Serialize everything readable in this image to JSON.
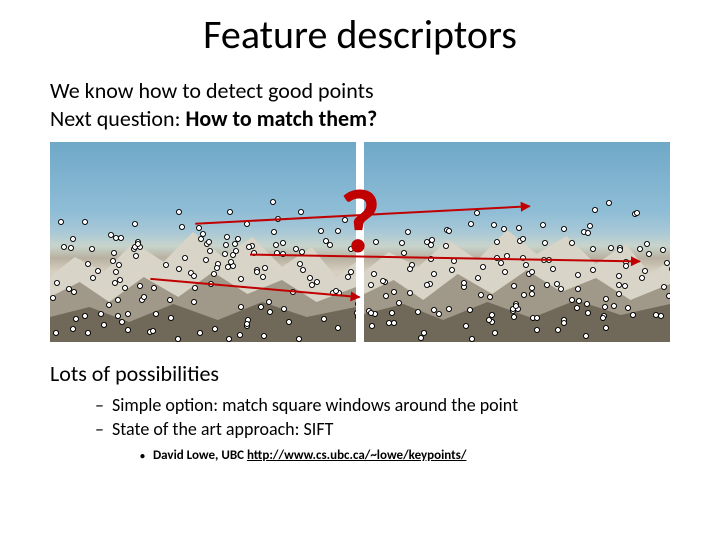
{
  "title": "Feature descriptors",
  "intro_line1": "We know how to detect good points",
  "intro_line2_a": "Next question: ",
  "intro_line2_b": "How to match them?",
  "qmark": "?",
  "poss_title": "Lots of possibilities",
  "bullet1": "Simple option:  match square windows around the point",
  "bullet2": "State of the art approach:  SIFT",
  "subbullet_author": "David Lowe, UBC ",
  "subbullet_link": "http://www.cs.ubc.ca/~lowe/keypoints/"
}
